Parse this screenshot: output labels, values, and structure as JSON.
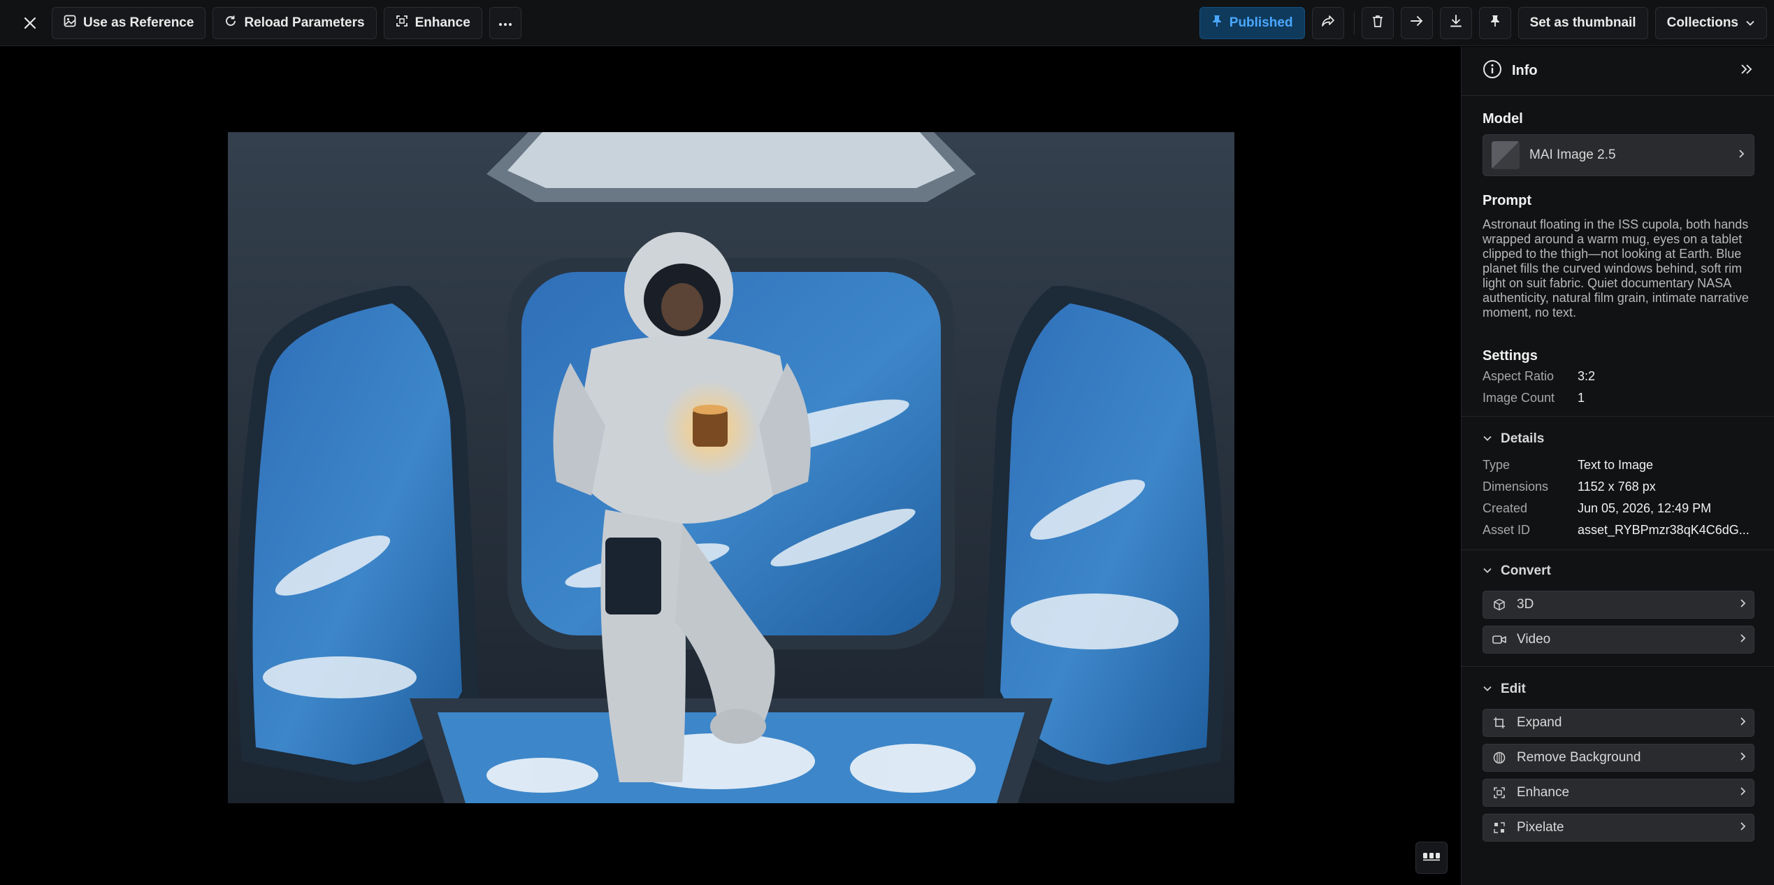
{
  "toolbar": {
    "use_as_reference": "Use as Reference",
    "reload_parameters": "Reload Parameters",
    "enhance": "Enhance",
    "published": "Published",
    "set_as_thumbnail": "Set as thumbnail",
    "collections": "Collections"
  },
  "icons": {
    "close": "close-icon",
    "image": "image-icon",
    "reload": "reload-icon",
    "enhance": "enhance-icon",
    "more": "more-horizontal-icon",
    "pin": "pin-icon",
    "share": "share-icon",
    "trash": "trash-icon",
    "arrow": "arrow-right-icon",
    "download": "download-icon",
    "chevron_down": "chevron-down-icon",
    "info": "info-icon",
    "collapse": "double-chevron-right-icon",
    "grid": "view-toggle-icon"
  },
  "colors": {
    "accent": "#4aa8ff",
    "published_bg": "#0f3a5c",
    "panel_bg": "#111214",
    "card_bg": "#2a2b2f"
  },
  "panel": {
    "title": "Info",
    "model": {
      "heading": "Model",
      "name": "MAI Image 2.5"
    },
    "prompt": {
      "heading": "Prompt",
      "text": "Astronaut floating in the ISS cupola, both hands wrapped around a warm mug, eyes on a tablet clipped to the thigh—not looking at Earth. Blue planet fills the curved windows behind, soft rim light on suit fabric. Quiet documentary NASA authenticity, natural film grain, intimate narrative moment, no text."
    },
    "settings": {
      "heading": "Settings",
      "rows": [
        {
          "key": "Aspect Ratio",
          "value": "3:2"
        },
        {
          "key": "Image Count",
          "value": "1"
        }
      ]
    },
    "details": {
      "heading": "Details",
      "rows": [
        {
          "key": "Type",
          "value": "Text to Image"
        },
        {
          "key": "Dimensions",
          "value": "1152 x 768 px"
        },
        {
          "key": "Created",
          "value": "Jun 05, 2026, 12:49 PM"
        },
        {
          "key": "Asset ID",
          "value": "asset_RYBPmzr38qK4C6dG..."
        }
      ]
    },
    "convert": {
      "heading": "Convert",
      "items": [
        "3D",
        "Video"
      ]
    },
    "edit": {
      "heading": "Edit",
      "items": [
        "Expand",
        "Remove Background",
        "Enhance",
        "Pixelate"
      ]
    }
  }
}
